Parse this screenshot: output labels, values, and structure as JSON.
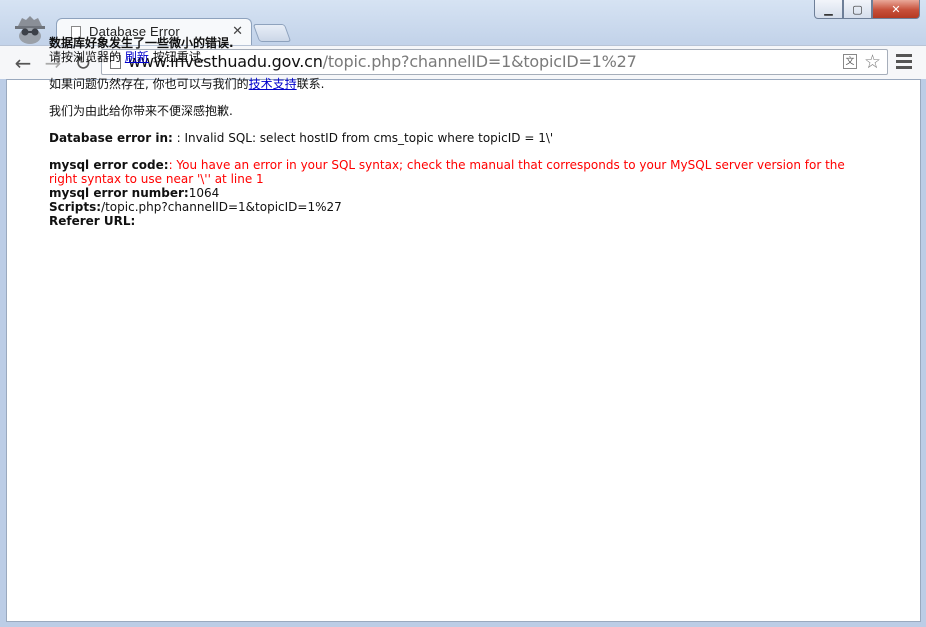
{
  "window": {
    "min_glyph": "▁",
    "max_glyph": "▢",
    "close_glyph": "✕"
  },
  "tab": {
    "title": "Database Error",
    "close_glyph": "✕"
  },
  "toolbar": {
    "back_glyph": "←",
    "forward_glyph": "→",
    "reload_glyph": "↻",
    "url_domain": "www.investhuadu.gov.cn",
    "url_path": "/topic.php?channelID=1&topicID=1%27",
    "star_glyph": "☆"
  },
  "page": {
    "heading": "数据库好象发生了一些微小的错误.",
    "line2_pre": "请按浏览器的",
    "refresh_link": "刷新",
    "line2_post": "按钮重试.",
    "line3_pre": "如果问题仍然存在, 你也可以与我们的",
    "support_link": "技术支持",
    "line3_post": "联系.",
    "apology": "我们为由此给你带来不便深感抱歉.",
    "db_error_label": "Database error in:",
    "db_error_value": ": Invalid SQL: select hostID from cms_topic where topicID = 1\\'",
    "mysql_code_label": "mysql error code:",
    "mysql_code_value": ": You have an error in your SQL syntax; check the manual that corresponds to your MySQL server version for the right syntax to use near '\\'' at line 1",
    "mysql_number_label": "mysql error number:",
    "mysql_number_value": "1064",
    "scripts_label": "Scripts:",
    "scripts_value": "/topic.php?channelID=1&topicID=1%27",
    "referer_label": "Referer URL:"
  },
  "colors": {
    "error_text": "#ff0000",
    "link": "#0000cc"
  }
}
